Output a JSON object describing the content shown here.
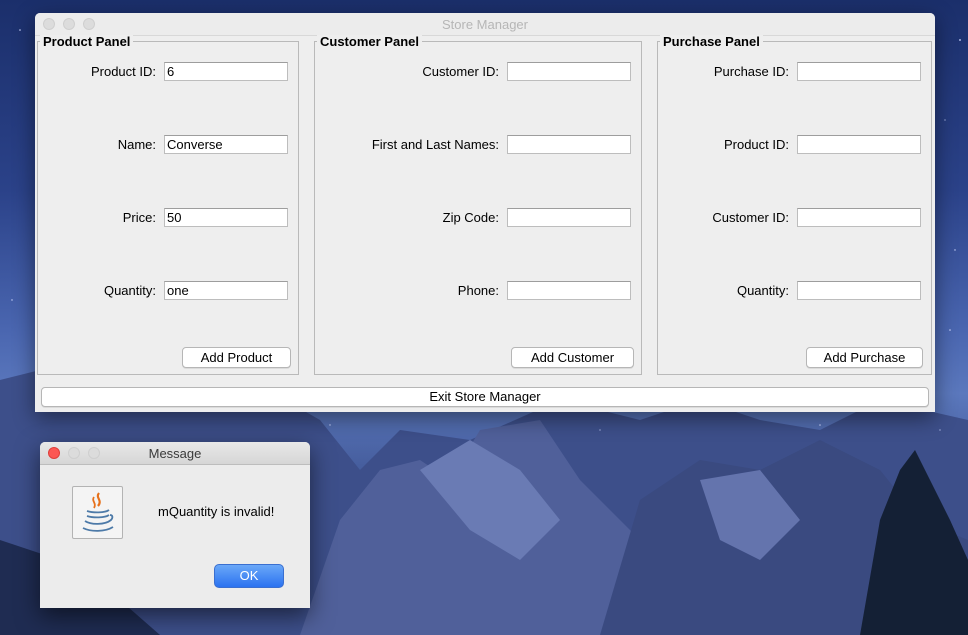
{
  "main_window": {
    "title": "Store Manager",
    "exit_button": "Exit Store Manager"
  },
  "product_panel": {
    "title": "Product Panel",
    "fields": [
      {
        "label": "Product ID:",
        "value": "6"
      },
      {
        "label": "Name:",
        "value": "Converse"
      },
      {
        "label": "Price:",
        "value": "50"
      },
      {
        "label": "Quantity:",
        "value": "one"
      }
    ],
    "button": "Add Product"
  },
  "customer_panel": {
    "title": "Customer Panel",
    "fields": [
      {
        "label": "Customer ID:",
        "value": ""
      },
      {
        "label": "First and Last Names:",
        "value": ""
      },
      {
        "label": "Zip Code:",
        "value": ""
      },
      {
        "label": "Phone:",
        "value": ""
      }
    ],
    "button": "Add Customer"
  },
  "purchase_panel": {
    "title": "Purchase Panel",
    "fields": [
      {
        "label": "Purchase ID:",
        "value": ""
      },
      {
        "label": "Product ID:",
        "value": ""
      },
      {
        "label": "Customer ID:",
        "value": ""
      },
      {
        "label": "Quantity:",
        "value": ""
      }
    ],
    "button": "Add Purchase"
  },
  "dialog": {
    "title": "Message",
    "message": "mQuantity is invalid!",
    "ok_label": "OK",
    "icon": "java-coffee-cup-icon"
  },
  "colors": {
    "close_red": "#fc5753",
    "ok_blue": "#2b72f0",
    "window_bg": "#eeeeee"
  }
}
